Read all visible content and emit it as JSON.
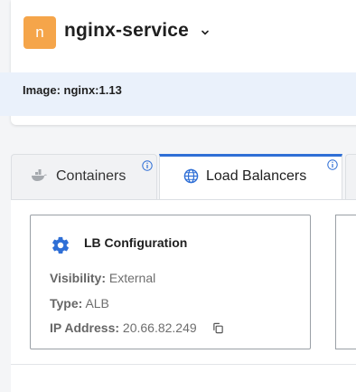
{
  "header": {
    "avatar_letter": "n",
    "service_name": "nginx-service",
    "image_text": "Image: nginx:1.13"
  },
  "tabs": [
    {
      "label": "Containers",
      "icon": "docker-whale-icon",
      "active": false
    },
    {
      "label": "Load Balancers",
      "icon": "globe-icon",
      "active": true
    }
  ],
  "card": {
    "title": "LB Configuration",
    "icon": "gear-icon",
    "fields": [
      {
        "key": "Visibility:",
        "value": "External"
      },
      {
        "key": "Type:",
        "value": "ALB"
      },
      {
        "key": "IP Address:",
        "value": "20.66.82.249"
      }
    ]
  },
  "colors": {
    "avatar": "#f5a54a",
    "accent_blue": "#2f6fd6",
    "header_strip": "#eaf1fb"
  }
}
